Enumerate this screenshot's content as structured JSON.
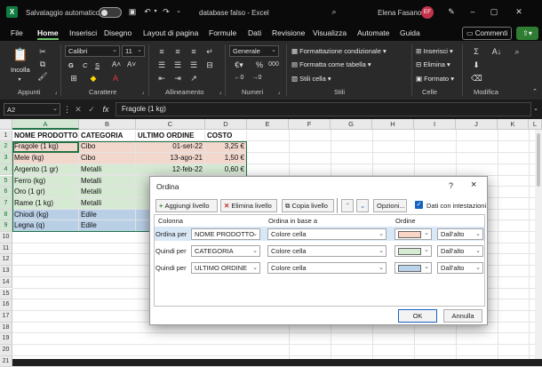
{
  "title": {
    "autosave_label": "Salvataggio automatico",
    "document": "database falso  -  Excel",
    "user": "Elena Fasano",
    "initials": "EF"
  },
  "menu": [
    "File",
    "Home",
    "Inserisci",
    "Disegno",
    "Layout di pagina",
    "Formule",
    "Dati",
    "Revisione",
    "Visualizza",
    "Automate",
    "Guida"
  ],
  "menu_active": "Home",
  "comments_label": "Commenti",
  "ribbon": {
    "paste": "Incolla",
    "groups": {
      "clipboard": "Appunti",
      "font": "Carattere",
      "alignment": "Allineamento",
      "number": "Numeri",
      "styles": "Stili",
      "cells": "Celle",
      "editing": "Modifica"
    },
    "font_name": "Calibri",
    "font_size": "11",
    "number_format": "Generale",
    "cond_format": "Formattazione condizionale",
    "format_table": "Formatta come tabella",
    "cell_styles": "Stili cella",
    "insert": "Inserisci",
    "delete": "Elimina",
    "format": "Formato",
    "font_buttons": [
      "G",
      "C",
      "S"
    ]
  },
  "formula_bar": {
    "cell_ref": "A2",
    "fx": "fx",
    "value": "Fragole (1 kg)"
  },
  "columns": [
    "A",
    "B",
    "C",
    "D",
    "E",
    "F",
    "G",
    "H",
    "I",
    "J",
    "K",
    "L"
  ],
  "rows": [
    "1",
    "2",
    "3",
    "4",
    "5",
    "6",
    "7",
    "8",
    "9",
    "10",
    "11",
    "12",
    "13",
    "14",
    "15",
    "16",
    "17",
    "18",
    "19",
    "20",
    "21"
  ],
  "sheet": {
    "headers": [
      "NOME PRODOTTO",
      "CATEGORIA",
      "ULTIMO ORDINE",
      "COSTO"
    ],
    "data": [
      {
        "name": "Fragole (1 kg)",
        "category": "Cibo",
        "date": "01-set-22",
        "cost": "3,25 €",
        "fill": "#f2d7cd"
      },
      {
        "name": "Mele (kg)",
        "category": "Cibo",
        "date": "13-ago-21",
        "cost": "1,50 €",
        "fill": "#f2d7cd"
      },
      {
        "name": "Argento (1 gr)",
        "category": "Metalli",
        "date": "12-feb-22",
        "cost": "0,60 €",
        "fill": "#d6e9d3"
      },
      {
        "name": "Ferro (kg)",
        "category": "Metalli",
        "date": "",
        "cost": "",
        "fill": "#d6e9d3"
      },
      {
        "name": "Oro (1 gr)",
        "category": "Metalli",
        "date": "",
        "cost": "",
        "fill": "#d6e9d3"
      },
      {
        "name": "Rame (1 kg)",
        "category": "Metalli",
        "date": "",
        "cost": "",
        "fill": "#d6e9d3"
      },
      {
        "name": "Chiodi (kg)",
        "category": "Edile",
        "date": "",
        "cost": "",
        "fill": "#b8cfe6"
      },
      {
        "name": "Legna (q)",
        "category": "Edile",
        "date": "",
        "cost": "",
        "fill": "#b8cfe6"
      }
    ]
  },
  "dialog": {
    "title": "Ordina",
    "help": "?",
    "close": "×",
    "add_level": "Aggiungi livello",
    "delete_level": "Elimina livello",
    "copy_level": "Copia livello",
    "options": "Opzioni...",
    "headers_check": "Dati con intestazioni",
    "col_column": "Colonna",
    "col_sorton": "Ordina in base a",
    "col_order": "Ordine",
    "levels": [
      {
        "label": "Ordina per",
        "column": "NOME PRODOTTO",
        "sort_on": "Colore cella",
        "color": "#f8d5c6",
        "order": "Dall'alto"
      },
      {
        "label": "Quindi per",
        "column": "CATEGORIA",
        "sort_on": "Colore cella",
        "color": "#d6ecd2",
        "order": "Dall'alto"
      },
      {
        "label": "Quindi per",
        "column": "ULTIMO ORDINE",
        "sort_on": "Colore cella",
        "color": "#b9d3ec",
        "order": "Dall'alto"
      }
    ],
    "ok": "OK",
    "cancel": "Annulla"
  },
  "colors": {
    "accent": "#217346",
    "titlebar": "#0a0a0a",
    "ribbon": "#2a2a2a",
    "excel_icon": "#107c41",
    "avatar": "#c4314b"
  }
}
